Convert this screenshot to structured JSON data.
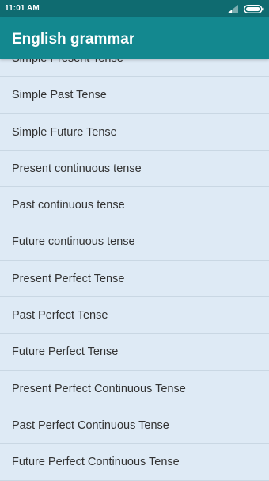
{
  "status_bar": {
    "time": "11:01 AM"
  },
  "app_bar": {
    "title": "English grammar"
  },
  "list": {
    "items": [
      "Simple Present Tense",
      "Simple Past Tense",
      "Simple Future Tense",
      "Present continuous tense",
      "Past continuous tense",
      "Future continuous tense",
      "Present Perfect Tense",
      "Past Perfect Tense",
      "Future Perfect Tense",
      "Present Perfect Continuous Tense",
      "Past Perfect Continuous Tense",
      "Future Perfect Continuous Tense"
    ]
  },
  "colors": {
    "status_bar": "#0f6b70",
    "app_bar": "#13888f",
    "list_background": "#deeaf5",
    "divider": "#c9d7e3",
    "item_text": "#333333"
  },
  "icons": [
    "signal-icon",
    "battery-icon"
  ]
}
